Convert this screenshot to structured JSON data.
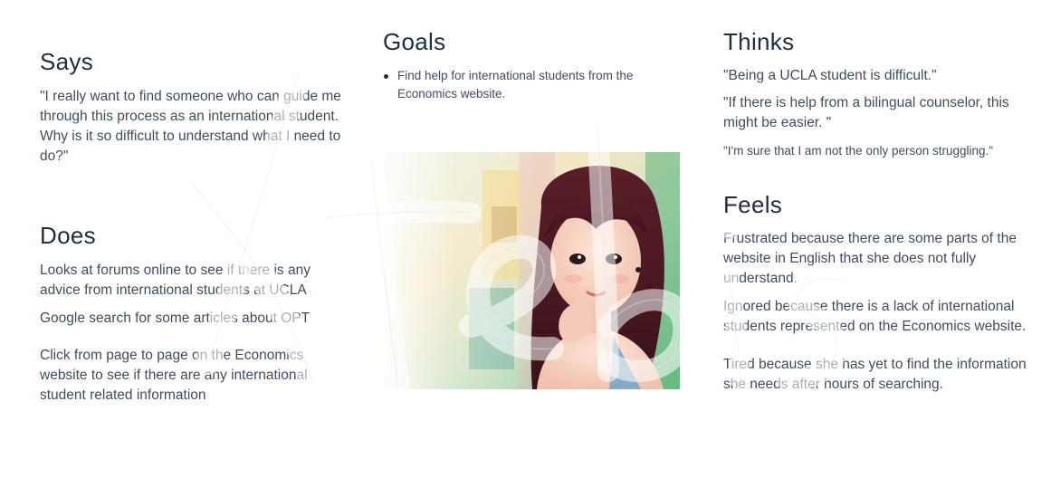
{
  "says": {
    "title": "Says",
    "text": "\"I really want to find someone who can guide me through this process as an international student. Why is it so difficult to understand what I need to do?\""
  },
  "does": {
    "title": "Does",
    "items": [
      "Looks at forums online to see if there is any advice from international students at UCLA",
      "Google search for some articles about OPT",
      "Click from page to page on the Economics website to see if there are any international student related information"
    ]
  },
  "goals": {
    "title": "Goals",
    "items": [
      "Find help for international students from the Economics website."
    ]
  },
  "thinks": {
    "title": "Thinks",
    "items": [
      "\"Being a UCLA student is difficult.\"",
      "\"If there is help from a bilingual counselor, this might be easier. \"",
      "\"I'm sure that I am not the only person struggling.\""
    ]
  },
  "feels": {
    "title": "Feels",
    "items": [
      "Frustrated because there are some parts of the website in English that she does not fully understand.",
      "Ignored because there is a lack of international students represented on the Economics website.",
      "Tired because she has yet to find the information she needs after hours of searching."
    ]
  },
  "watermark": {
    "text": "Xtebis"
  },
  "colors": {
    "heading": "#1f2d3d",
    "body_text": "#3f4d5d",
    "background": "#ffffff"
  }
}
